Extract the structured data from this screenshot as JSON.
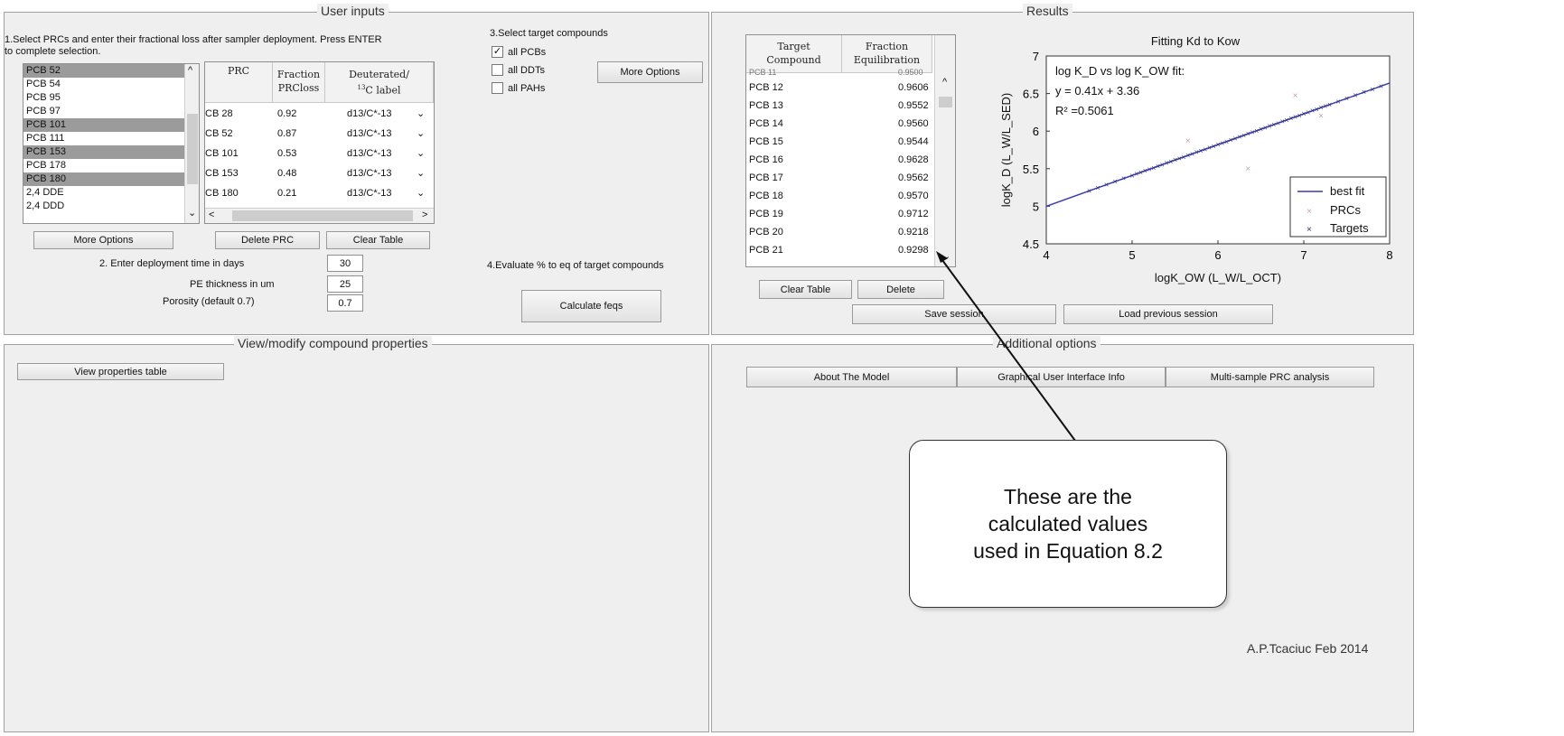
{
  "user_inputs": {
    "title": "User inputs",
    "step1_text": "1.Select PRCs and enter their fractional loss after sampler deployment. Press ENTER",
    "step1_text2": "to complete selection.",
    "prc_list": [
      "PCB 52",
      "PCB 54",
      "PCB 95",
      "PCB 97",
      "PCB 101",
      "PCB 111",
      "PCB 153",
      "PCB 178",
      "PCB 180",
      "2,4 DDE",
      "2,4 DDD"
    ],
    "prc_selected": [
      true,
      false,
      false,
      false,
      true,
      false,
      true,
      false,
      true,
      false,
      false
    ],
    "prc_table": {
      "headers": {
        "prc": "PRC",
        "fraction": "Fraction PRCloss",
        "deut": "Deuterated/ 13C label"
      },
      "rows": [
        {
          "prc": "CB 28",
          "fraction": "0.92",
          "label": "d13/C*-13"
        },
        {
          "prc": "CB 52",
          "fraction": "0.87",
          "label": "d13/C*-13"
        },
        {
          "prc": "CB 101",
          "fraction": "0.53",
          "label": "d13/C*-13"
        },
        {
          "prc": "CB 153",
          "fraction": "0.48",
          "label": "d13/C*-13"
        },
        {
          "prc": "CB 180",
          "fraction": "0.21",
          "label": "d13/C*-13"
        }
      ]
    },
    "more_options_left": "More Options",
    "delete_prc": "Delete PRC",
    "clear_table": "Clear Table",
    "step2_label": "2. Enter deployment time in days",
    "deploy_days": "30",
    "pe_label": "PE thickness in um",
    "pe_value": "25",
    "porosity_label": "Porosity (default 0.7)",
    "porosity_value": "0.7",
    "step3_label": "3.Select target compounds",
    "targets": [
      {
        "label": "all PCBs",
        "checked": true
      },
      {
        "label": "all DDTs",
        "checked": false
      },
      {
        "label": "all PAHs",
        "checked": false
      }
    ],
    "more_options_right": "More Options",
    "step4_label": "4.Evaluate % to eq of target compounds",
    "calculate_button": "Calculate feqs"
  },
  "results": {
    "title": "Results",
    "table_headers": {
      "target": "Target Compound",
      "fraction": "Fraction Equilibration"
    },
    "partial_row": {
      "compound": "PCB 11",
      "value": "0.9500"
    },
    "rows": [
      {
        "compound": "PCB 12",
        "value": "0.9606"
      },
      {
        "compound": "PCB 13",
        "value": "0.9552"
      },
      {
        "compound": "PCB 14",
        "value": "0.9560"
      },
      {
        "compound": "PCB 15",
        "value": "0.9544"
      },
      {
        "compound": "PCB 16",
        "value": "0.9628"
      },
      {
        "compound": "PCB 17",
        "value": "0.9562"
      },
      {
        "compound": "PCB 18",
        "value": "0.9570"
      },
      {
        "compound": "PCB 19",
        "value": "0.9712"
      },
      {
        "compound": "PCB 20",
        "value": "0.9218"
      },
      {
        "compound": "PCB 21",
        "value": "0.9298"
      }
    ],
    "clear_table": "Clear Table",
    "delete": "Delete",
    "save_session": "Save session",
    "load_session": "Load previous session"
  },
  "chart_data": {
    "type": "scatter",
    "title": "Fitting Kd to Kow",
    "xlabel": "logK_OW (L_W/L_OCT)",
    "ylabel": "logK_D (L_W/L_SED)",
    "xlim": [
      4,
      8
    ],
    "ylim": [
      4.5,
      7
    ],
    "x_ticks": [
      "4",
      "5",
      "6",
      "7",
      "8"
    ],
    "y_ticks": [
      "4.5",
      "5",
      "5.5",
      "6",
      "6.5",
      "7"
    ],
    "annotation_lines": [
      "log K_D vs log K_OW fit:",
      "y = 0.41x + 3.36",
      "R² =0.5061"
    ],
    "legend": [
      "best fit",
      "PRCs",
      "Targets"
    ],
    "legend_position": "bottom-right",
    "colors": {
      "fit": "#3a3ab0",
      "prcs": "#c8a0a0",
      "targets": "#33337a"
    },
    "fit_line": {
      "slope": 0.41,
      "intercept": 3.36
    },
    "prcs": [
      {
        "x": 5.65,
        "y": 5.87
      },
      {
        "x": 6.35,
        "y": 5.5
      },
      {
        "x": 6.9,
        "y": 6.47
      },
      {
        "x": 7.2,
        "y": 6.2
      }
    ],
    "targets_x": [
      4.5,
      4.6,
      4.7,
      4.8,
      4.9,
      5.0,
      5.05,
      5.1,
      5.15,
      5.2,
      5.25,
      5.3,
      5.35,
      5.4,
      5.45,
      5.5,
      5.55,
      5.6,
      5.65,
      5.7,
      5.75,
      5.8,
      5.85,
      5.9,
      5.95,
      6.0,
      6.05,
      6.1,
      6.15,
      6.2,
      6.25,
      6.3,
      6.35,
      6.4,
      6.45,
      6.5,
      6.55,
      6.6,
      6.65,
      6.7,
      6.75,
      6.8,
      6.85,
      6.9,
      6.95,
      7.0,
      7.05,
      7.1,
      7.15,
      7.2,
      7.25,
      7.3,
      7.4,
      7.5,
      7.6,
      7.7,
      7.8,
      7.9
    ]
  },
  "bottom_left": {
    "title": "View/modify compound properties",
    "view_button": "View properties table"
  },
  "bottom_right": {
    "title": "Additional options",
    "about": "About The Model",
    "gui_info": "Graphical User Interface Info",
    "multi": "Multi-sample PRC analysis",
    "credit": "A.P.Tcaciuc Feb 2014"
  },
  "callout": {
    "line1": "These are the",
    "line2": "calculated values",
    "line3": "used in Equation 8.2"
  }
}
